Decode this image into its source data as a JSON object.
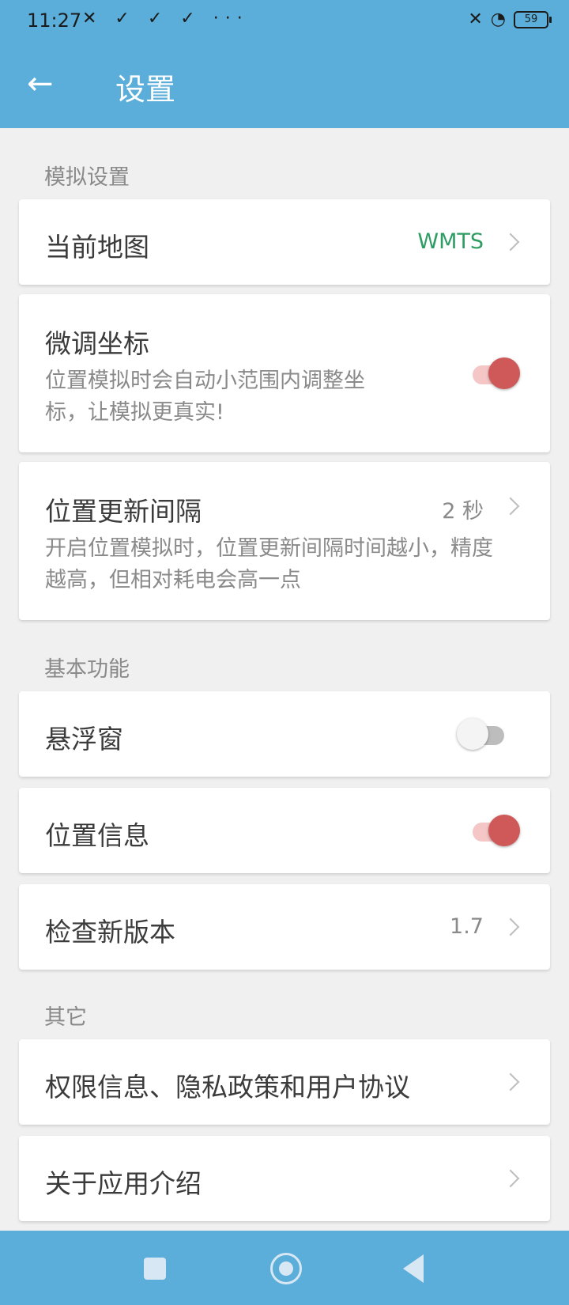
{
  "status": {
    "time": "11:27",
    "left_icons": "✕ ✓ ✓ ✓ ···",
    "battery": "59"
  },
  "header": {
    "back_icon": "←",
    "title": "设置"
  },
  "sections": {
    "simulation": {
      "title": "模拟设置",
      "current_map": {
        "label": "当前地图",
        "value": "WMTS"
      },
      "fine_tune": {
        "label": "微调坐标",
        "desc": "位置模拟时会自动小范围内调整坐标，让模拟更真实!",
        "enabled": true
      },
      "update_interval": {
        "label": "位置更新间隔",
        "value": "2 秒",
        "desc": "开启位置模拟时，位置更新间隔时间越小，精度越高，但相对耗电会高一点"
      }
    },
    "basic": {
      "title": "基本功能",
      "floating_window": {
        "label": "悬浮窗",
        "enabled": false
      },
      "location_info": {
        "label": "位置信息",
        "enabled": true
      },
      "check_version": {
        "label": "检查新版本",
        "value": "1.7"
      }
    },
    "other": {
      "title": "其它",
      "privacy": {
        "label": "权限信息、隐私政策和用户协议"
      },
      "partial_row": {
        "label": "关于应用介绍"
      }
    }
  },
  "colors": {
    "primary": "#5baed9",
    "toggle_on": "#cf5858",
    "value_green": "#2f9c63"
  }
}
